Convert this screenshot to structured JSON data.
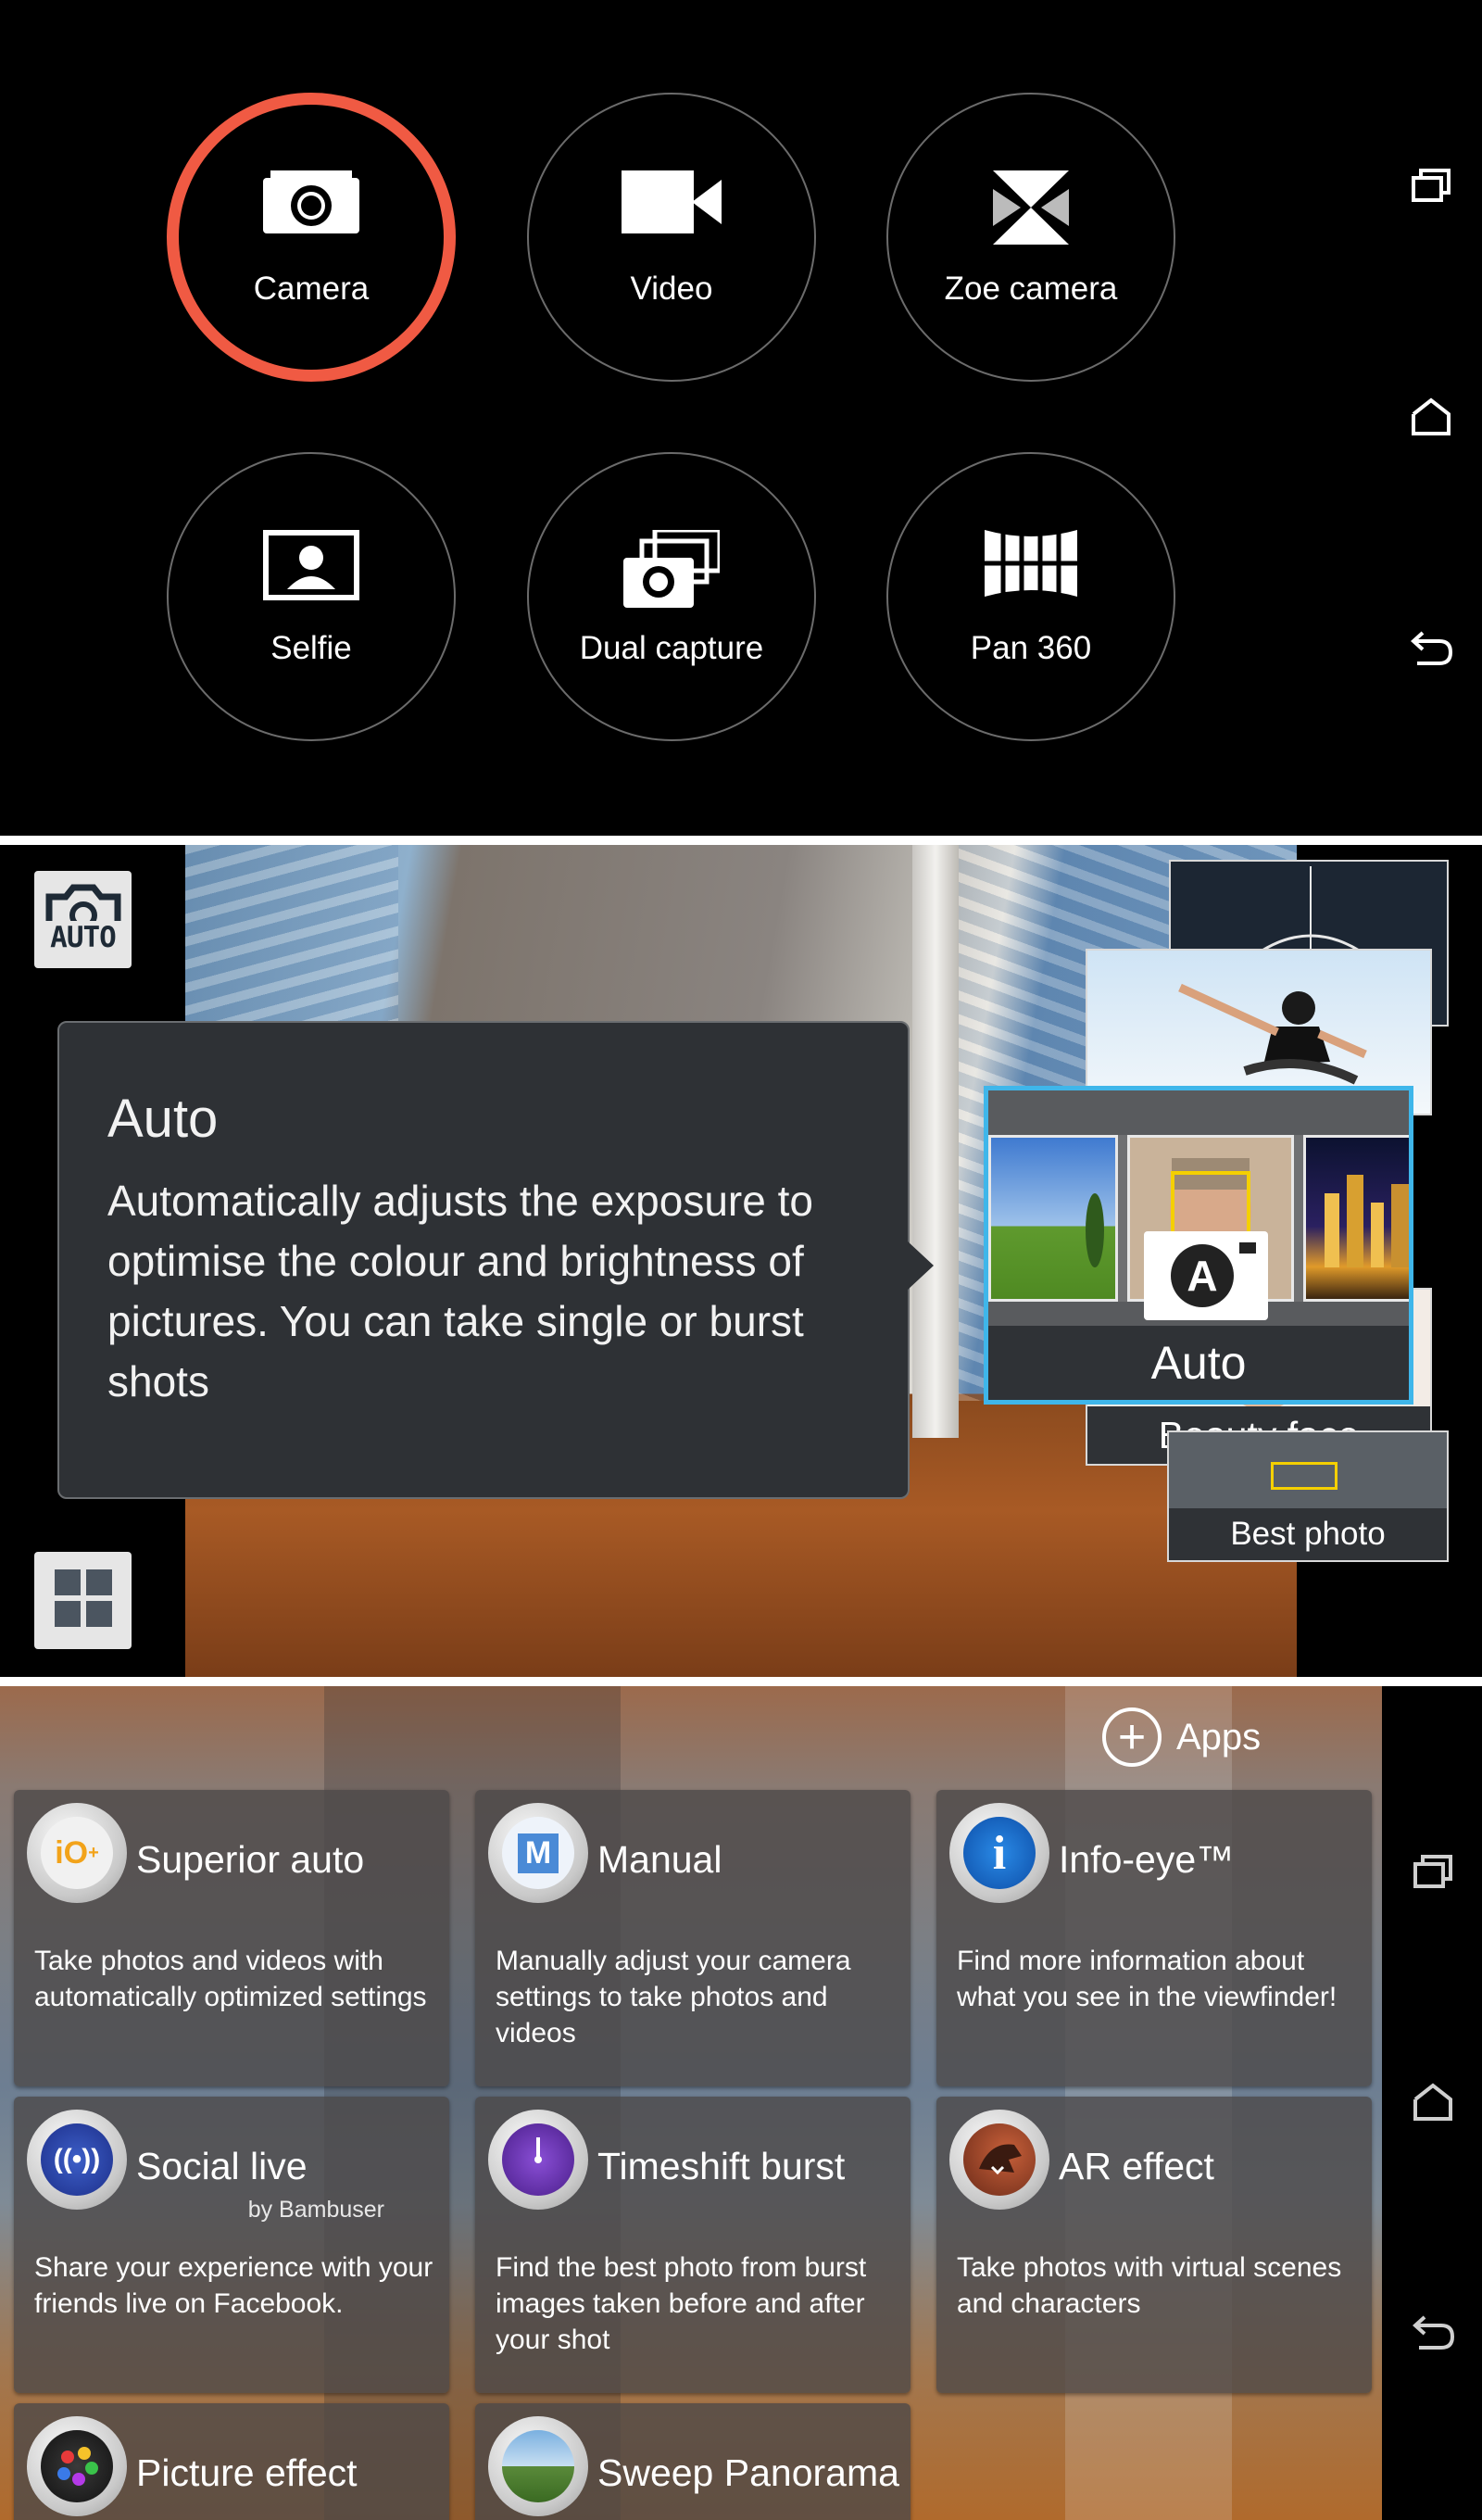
{
  "mode_picker": {
    "modes": [
      {
        "label": "Camera",
        "icon": "camera-icon",
        "selected": true
      },
      {
        "label": "Video",
        "icon": "video-icon",
        "selected": false
      },
      {
        "label": "Zoe camera",
        "icon": "zoe-icon",
        "selected": false
      },
      {
        "label": "Selfie",
        "icon": "selfie-icon",
        "selected": false
      },
      {
        "label": "Dual capture",
        "icon": "dual-capture-icon",
        "selected": false
      },
      {
        "label": "Pan 360",
        "icon": "pan360-icon",
        "selected": false
      }
    ],
    "accent_color": "#f05a43"
  },
  "viewfinder": {
    "auto_button_text": "AUTO",
    "callout": {
      "title": "Auto",
      "description": "Automatically adjusts the exposure to optimise the colour and brightness of pictures. You can take single or burst shots"
    },
    "carousel": {
      "selected": "Auto",
      "cards": [
        "Beauty face",
        "Best photo"
      ]
    },
    "accent_color": "#3fb6ea"
  },
  "apps_grid": {
    "apps_button": "Apps",
    "apps": [
      {
        "name": "Superior auto",
        "desc": "Take photos and videos with automatically optimized settings",
        "icon": "superior-auto-icon"
      },
      {
        "name": "Manual",
        "desc": "Manually adjust your camera settings to take photos and videos",
        "icon": "manual-icon"
      },
      {
        "name": "Info-eye™",
        "desc": "Find more information about what you see in the viewfinder!",
        "icon": "info-eye-icon"
      },
      {
        "name": "Social live",
        "sub": "by Bambuser",
        "desc": "Share your experience with your friends live on Facebook.",
        "icon": "social-live-icon"
      },
      {
        "name": "Timeshift burst",
        "desc": "Find the best photo from burst images taken before and after your shot",
        "icon": "timeshift-burst-icon"
      },
      {
        "name": "AR effect",
        "desc": "Take photos with virtual scenes and characters",
        "icon": "ar-effect-icon"
      },
      {
        "name": "Picture effect",
        "icon": "picture-effect-icon"
      },
      {
        "name": "Sweep Panorama",
        "icon": "sweep-panorama-icon"
      }
    ]
  }
}
